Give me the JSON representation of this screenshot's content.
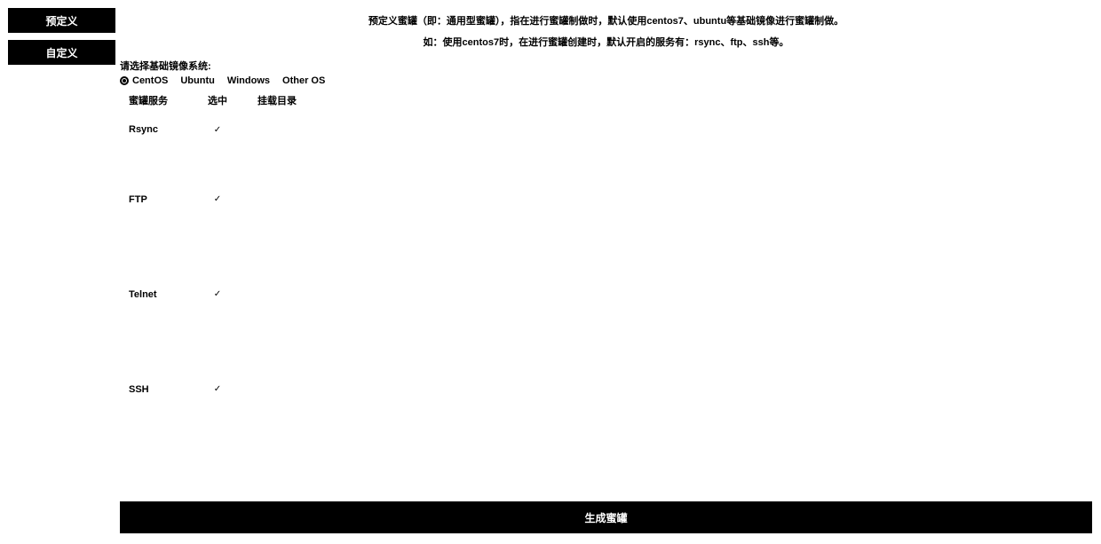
{
  "sidebar": {
    "predefined_label": "预定义",
    "custom_label": "自定义"
  },
  "info": {
    "line1": "预定义蜜罐（即：通用型蜜罐），指在进行蜜罐制做时，默认使用centos7、ubuntu等基础镜像进行蜜罐制做。",
    "line2": "如：使用centos7时，在进行蜜罐创建时，默认开启的服务有：rsync、ftp、ssh等。"
  },
  "os": {
    "label": "请选择基础镜像系统:",
    "options": [
      "CentOS",
      "Ubuntu",
      "Windows",
      "Other OS"
    ],
    "selected": "CentOS"
  },
  "table": {
    "headers": {
      "name": "蜜罐服务",
      "check": "选中",
      "dir": "挂载目录"
    },
    "rows": [
      {
        "name": "Rsync",
        "checked": true
      },
      {
        "name": "FTP",
        "checked": true
      },
      {
        "name": "Telnet",
        "checked": true
      },
      {
        "name": "SSH",
        "checked": true
      }
    ]
  },
  "footer": {
    "generate_label": "生成蜜罐"
  }
}
